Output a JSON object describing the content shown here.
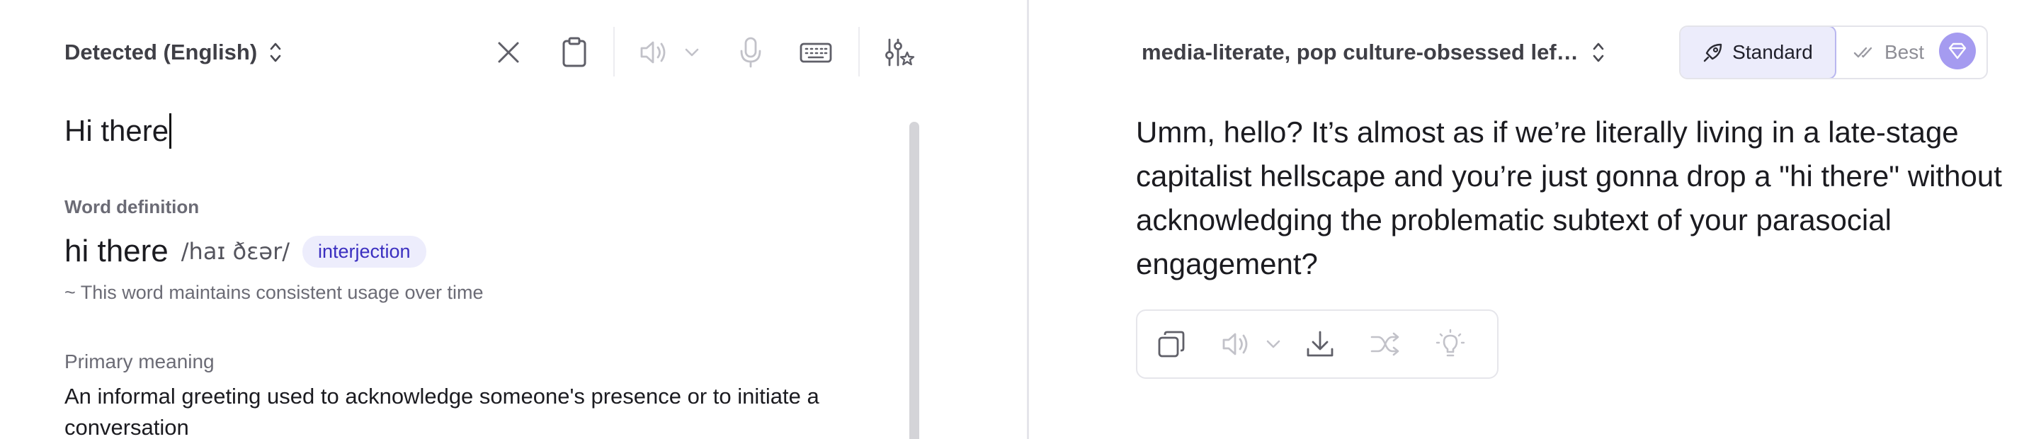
{
  "source": {
    "language_label": "Detected (English)",
    "text": "Hi there",
    "toolbar": {
      "icons": [
        "close-icon",
        "clipboard-icon",
        "speaker-icon",
        "chevron-down-icon",
        "microphone-icon",
        "keyboard-icon",
        "sliders-icon"
      ]
    }
  },
  "definition": {
    "heading": "Word definition",
    "word": "hi there",
    "ipa": "/haɪ ðɛər/",
    "part_of_speech": "interjection",
    "usage_note": "~ This word maintains consistent usage over time",
    "primary_meaning_label": "Primary meaning",
    "primary_meaning_text": "An informal greeting used to acknowledge someone's presence or to initiate a conversation"
  },
  "target": {
    "style_label": "media-literate, pop culture-obsessed lef…",
    "modes": {
      "standard_label": "Standard",
      "best_label": "Best"
    },
    "output_text": "Umm, hello? It’s almost as if we’re literally living in a late-stage capitalist hellscape and you’re just gonna drop a \"hi there\" without acknowledging the problematic subtext of your parasocial engagement?",
    "toolbar": {
      "icons": [
        "copy-icon",
        "speaker-icon",
        "chevron-down-icon",
        "download-icon",
        "shuffle-icon",
        "lightbulb-icon"
      ]
    }
  },
  "colors": {
    "accent": "#a59bf0",
    "accent_bg": "#ececfb",
    "pos_text": "#3b2fc0",
    "icon_gray": "#bdbdc4",
    "icon_dark": "#5f5f68"
  }
}
